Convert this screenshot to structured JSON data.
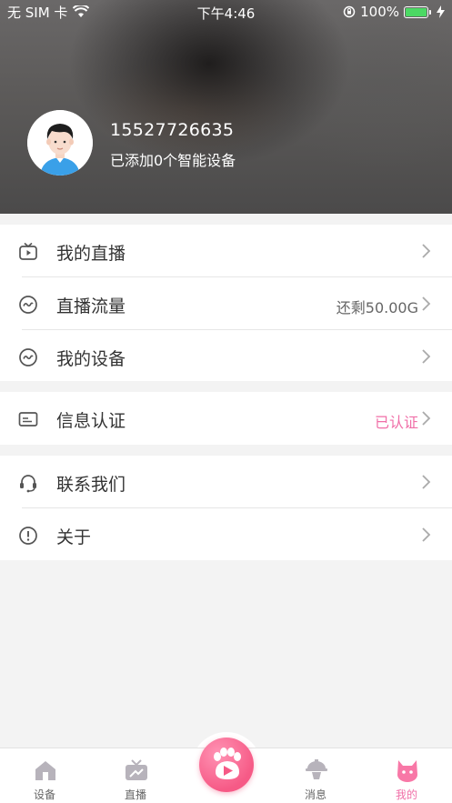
{
  "status_bar": {
    "carrier": "无 SIM 卡",
    "time": "下午4:46",
    "battery": "100%",
    "icons": [
      "wifi-icon",
      "rotation-lock-icon",
      "battery-icon",
      "charging-icon"
    ]
  },
  "profile": {
    "phone": "15527726635",
    "subtitle": "已添加0个智能设备",
    "avatar_icon": "user-avatar-icon"
  },
  "menu": {
    "group1": [
      {
        "label": "我的直播",
        "icon": "tv-icon",
        "value": ""
      },
      {
        "label": "直播流量",
        "icon": "wave-circle-icon",
        "value": "还剩50.00G"
      },
      {
        "label": "我的设备",
        "icon": "wave-circle-icon",
        "value": ""
      }
    ],
    "group2": [
      {
        "label": "信息认证",
        "icon": "id-card-icon",
        "value": "已认证"
      }
    ],
    "group3": [
      {
        "label": "联系我们",
        "icon": "headset-icon",
        "value": ""
      },
      {
        "label": "关于",
        "icon": "info-circle-icon",
        "value": ""
      }
    ]
  },
  "tabbar": {
    "tabs": [
      {
        "label": "设备",
        "icon": "home-icon"
      },
      {
        "label": "直播",
        "icon": "tv-tab-icon"
      },
      {
        "label": "消息",
        "icon": "message-icon"
      },
      {
        "label": "我的",
        "icon": "cat-profile-icon",
        "active": true
      }
    ],
    "center_icon": "paw-play-icon"
  },
  "colors": {
    "accent": "#f06ea7",
    "tab_icon": "#b7b3bb",
    "background": "#f3f3f3"
  }
}
